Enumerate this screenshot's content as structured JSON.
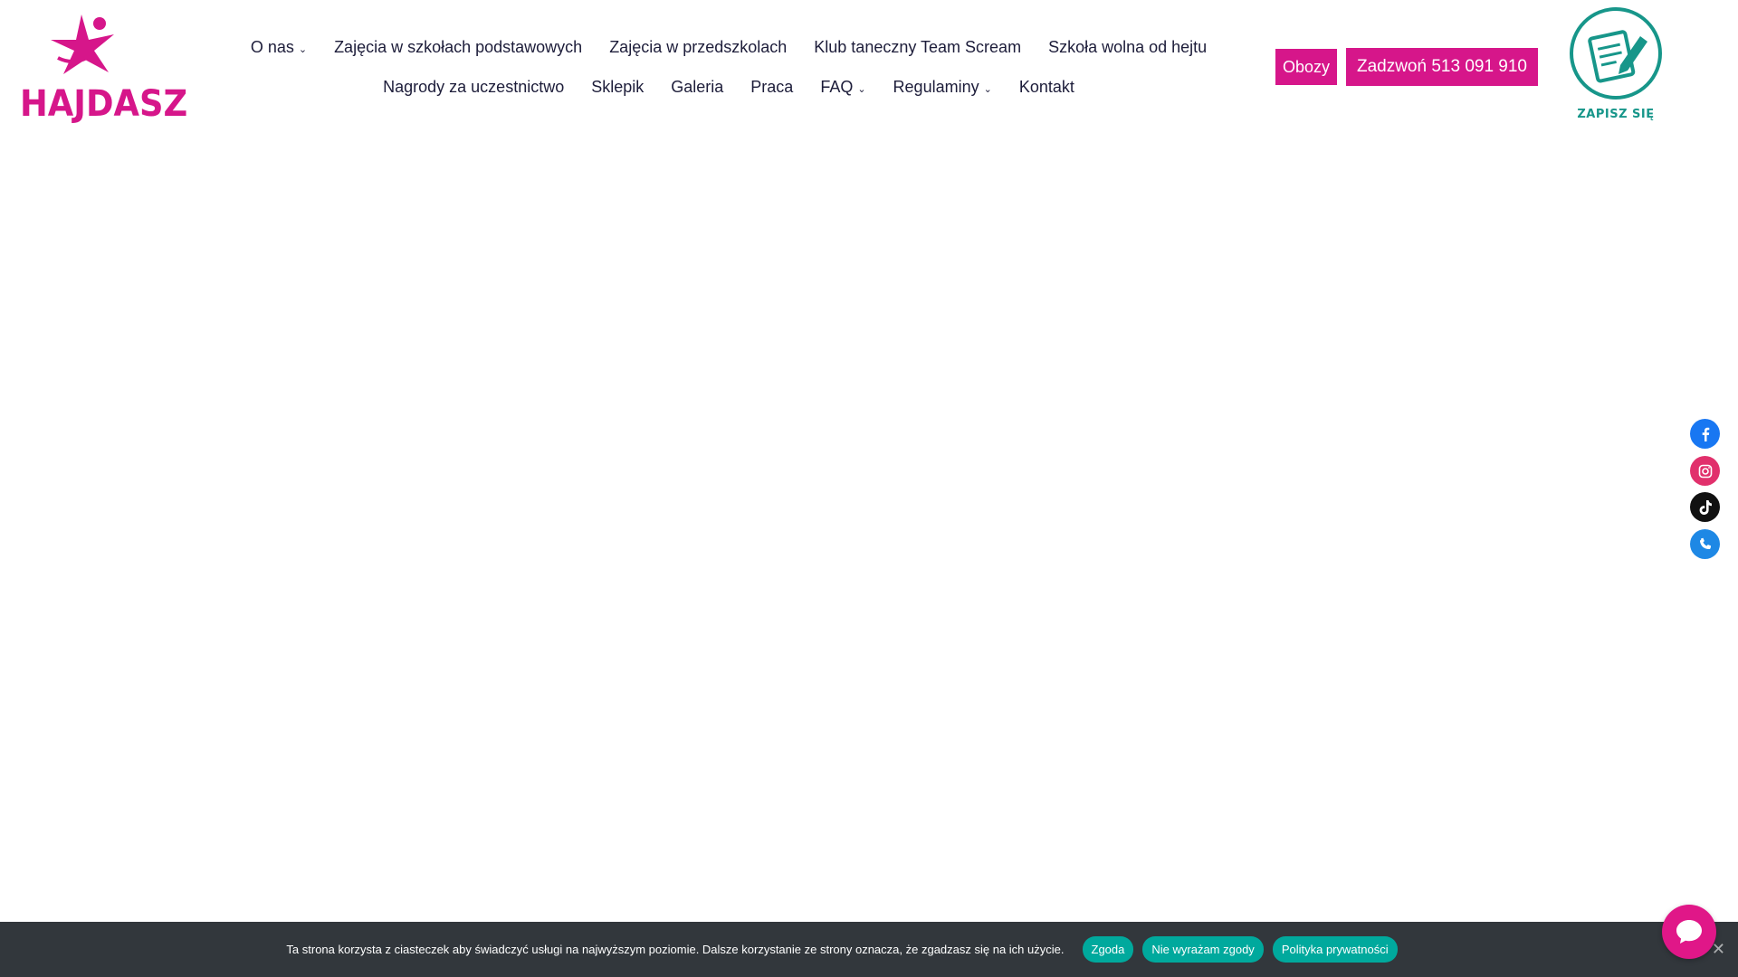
{
  "brand": {
    "logo_text": "HAJDASZ",
    "color": "#d6168a"
  },
  "nav": {
    "row1": [
      {
        "label": "O nas",
        "has_dropdown": true
      },
      {
        "label": "Zajęcia w szkołach podstawowych",
        "has_dropdown": false
      },
      {
        "label": "Zajęcia w przedszkolach",
        "has_dropdown": false
      },
      {
        "label": "Klub taneczny Team Scream",
        "has_dropdown": false
      },
      {
        "label": "Szkoła wolna od hejtu",
        "has_dropdown": false
      }
    ],
    "row2": [
      {
        "label": "Nagrody za uczestnictwo",
        "has_dropdown": false
      },
      {
        "label": "Sklepik",
        "has_dropdown": false
      },
      {
        "label": "Galeria",
        "has_dropdown": false
      },
      {
        "label": "Praca",
        "has_dropdown": false
      },
      {
        "label": "FAQ",
        "has_dropdown": true
      },
      {
        "label": "Regulaminy",
        "has_dropdown": true
      },
      {
        "label": "Kontakt",
        "has_dropdown": false
      }
    ]
  },
  "header_buttons": {
    "camps": "Obozy",
    "call": "Zadzwoń 513 091 910"
  },
  "signup": {
    "label": "ZAPISZ SIĘ",
    "color": "#17968a"
  },
  "social": {
    "items": [
      {
        "icon": "facebook-icon",
        "color": "#1877f2"
      },
      {
        "icon": "instagram-icon",
        "color": "#e1306c"
      },
      {
        "icon": "tiktok-icon",
        "color": "#111111"
      },
      {
        "icon": "phone-icon",
        "color": "#1e88e5"
      }
    ]
  },
  "cookie": {
    "text": "Ta strona korzysta z ciasteczek aby świadczyć usługi na najwyższym poziomie. Dalsze korzystanie ze strony oznacza, że zgadzasz się na ich użycie.",
    "accept": "Zgoda",
    "decline": "Nie wyrażam zgody",
    "privacy": "Polityka prywatności",
    "close": "✕"
  },
  "chat": {
    "icon": "chat-bubble-icon",
    "color": "#e01788"
  }
}
